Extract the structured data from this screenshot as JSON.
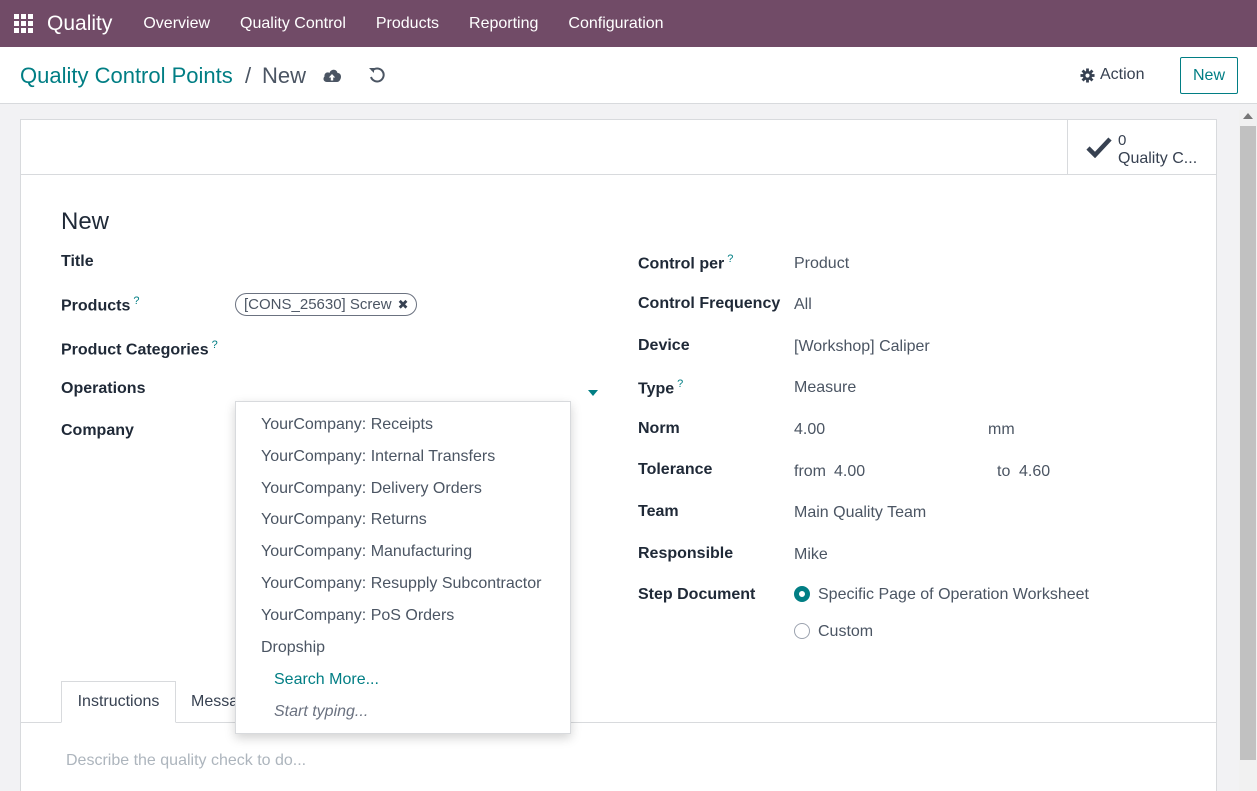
{
  "colors": {
    "topbar": "#714b67",
    "accent": "#017e84"
  },
  "topbar": {
    "app_name": "Quality",
    "menu": [
      "Overview",
      "Quality Control",
      "Products",
      "Reporting",
      "Configuration"
    ]
  },
  "breadcrumb": {
    "parent": "Quality Control Points",
    "separator": "/",
    "current": "New"
  },
  "toolbar": {
    "action_label": "Action",
    "new_label": "New"
  },
  "smart_button": {
    "count": "0",
    "label": "Quality C..."
  },
  "form": {
    "title": "New",
    "left": {
      "title_label": "Title",
      "products_label": "Products",
      "products_tag": "[CONS_25630] Screw",
      "product_categories_label": "Product Categories",
      "operations_label": "Operations",
      "company_label": "Company"
    },
    "right": {
      "control_per_label": "Control per",
      "control_per_value": "Product",
      "control_frequency_label": "Control Frequency",
      "control_frequency_value": "All",
      "device_label": "Device",
      "device_value": "[Workshop] Caliper",
      "type_label": "Type",
      "type_value": "Measure",
      "norm_label": "Norm",
      "norm_value": "4.00",
      "norm_unit": "mm",
      "tolerance_label": "Tolerance",
      "tolerance_from_label": "from",
      "tolerance_from": "4.00",
      "tolerance_to_label": "to",
      "tolerance_to": "4.60",
      "team_label": "Team",
      "team_value": "Main Quality Team",
      "responsible_label": "Responsible",
      "responsible_value": "Mike",
      "step_document_label": "Step Document",
      "step_document_options": [
        "Specific Page of Operation Worksheet",
        "Custom"
      ],
      "step_document_selected": "Specific Page of Operation Worksheet"
    }
  },
  "tabs": {
    "instructions": "Instructions",
    "message": "Messa"
  },
  "instructions_placeholder": "Describe the quality check to do...",
  "operations_dropdown": {
    "items": [
      "YourCompany: Receipts",
      "YourCompany: Internal Transfers",
      "YourCompany: Delivery Orders",
      "YourCompany: Returns",
      "YourCompany: Manufacturing",
      "YourCompany: Resupply Subcontractor",
      "YourCompany: PoS Orders",
      "Dropship"
    ],
    "search_more": "Search More...",
    "start_typing": "Start typing..."
  }
}
